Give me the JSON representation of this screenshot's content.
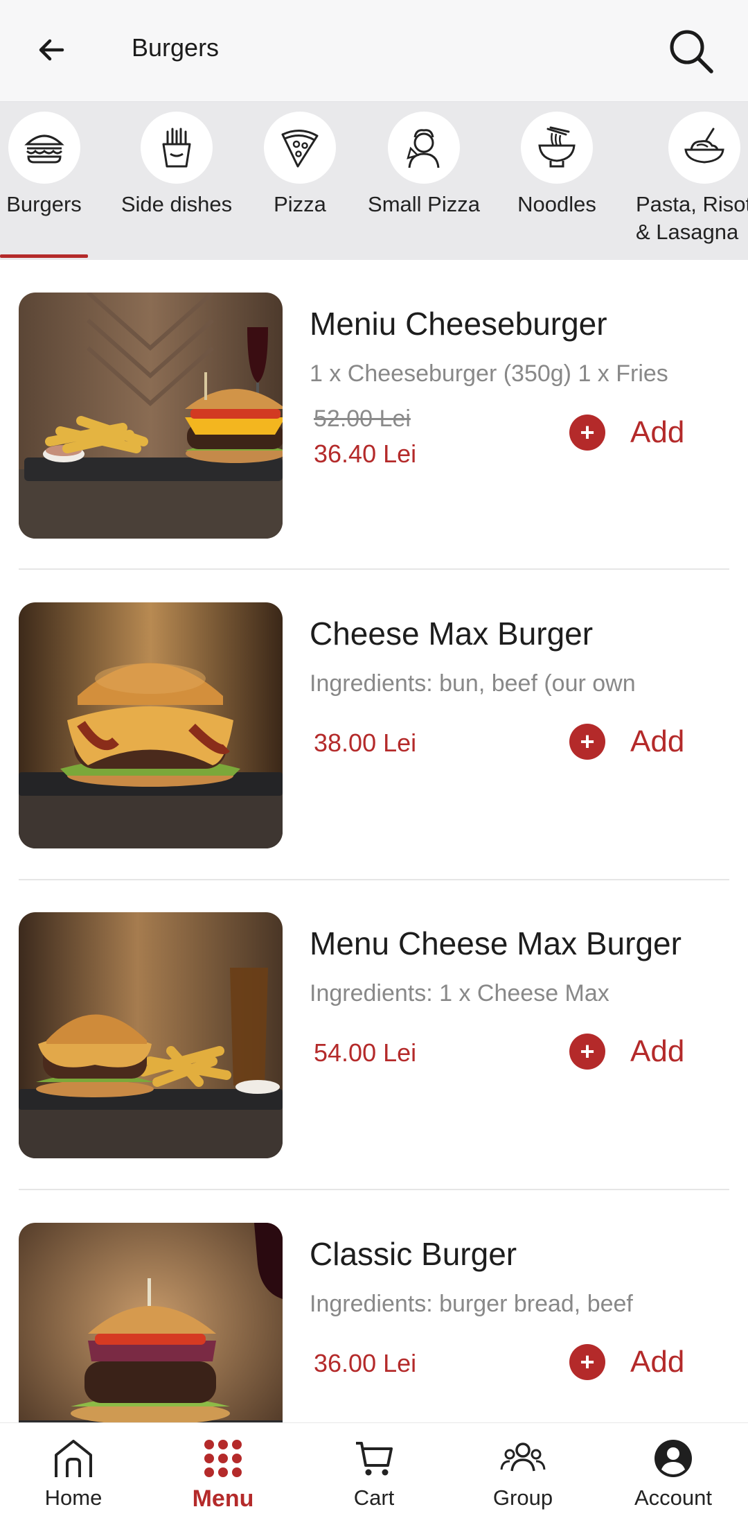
{
  "header": {
    "title": "Burgers",
    "back_icon": "arrow-left-icon",
    "search_icon": "search-icon"
  },
  "categories": [
    {
      "label": "Burgers",
      "icon": "burger-icon",
      "selected": true
    },
    {
      "label": "Side dishes",
      "icon": "fries-icon",
      "selected": false
    },
    {
      "label": "Pizza",
      "icon": "pizza-slice-icon",
      "selected": false
    },
    {
      "label": "Small Pizza",
      "icon": "chef-pizza-icon",
      "selected": false
    },
    {
      "label": "Noodles",
      "icon": "noodle-bowl-icon",
      "selected": false
    },
    {
      "label": "Pasta, Risot\n& Lasagna",
      "icon": "pasta-plate-icon",
      "selected": false
    }
  ],
  "products": [
    {
      "name": "Meniu Cheeseburger",
      "description": "1 x Cheeseburger (350g) 1 x Fries",
      "old_price": "52.00 Lei",
      "price": "36.40 Lei",
      "add_label": "Add"
    },
    {
      "name": "Cheese Max Burger",
      "description": "Ingredients: bun, beef (our own",
      "price": "38.00 Lei",
      "add_label": "Add"
    },
    {
      "name": "Menu Cheese Max Burger",
      "description": " Ingredients: 1 x Cheese Max",
      "price": "54.00 Lei",
      "add_label": "Add"
    },
    {
      "name": "Classic Burger",
      "description": "Ingredients: burger bread, beef",
      "price": "36.00 Lei",
      "add_label": "Add"
    }
  ],
  "bottom_nav": [
    {
      "label": "Home",
      "icon": "home-icon",
      "active": false
    },
    {
      "label": "Menu",
      "icon": "grid-dots-icon",
      "active": true
    },
    {
      "label": "Cart",
      "icon": "cart-icon",
      "active": false
    },
    {
      "label": "Group",
      "icon": "group-icon",
      "active": false
    },
    {
      "label": "Account",
      "icon": "account-icon",
      "active": false
    }
  ],
  "colors": {
    "accent": "#b42a2a",
    "header_bg": "#f7f7f8",
    "category_bg": "#e9e9eb"
  }
}
